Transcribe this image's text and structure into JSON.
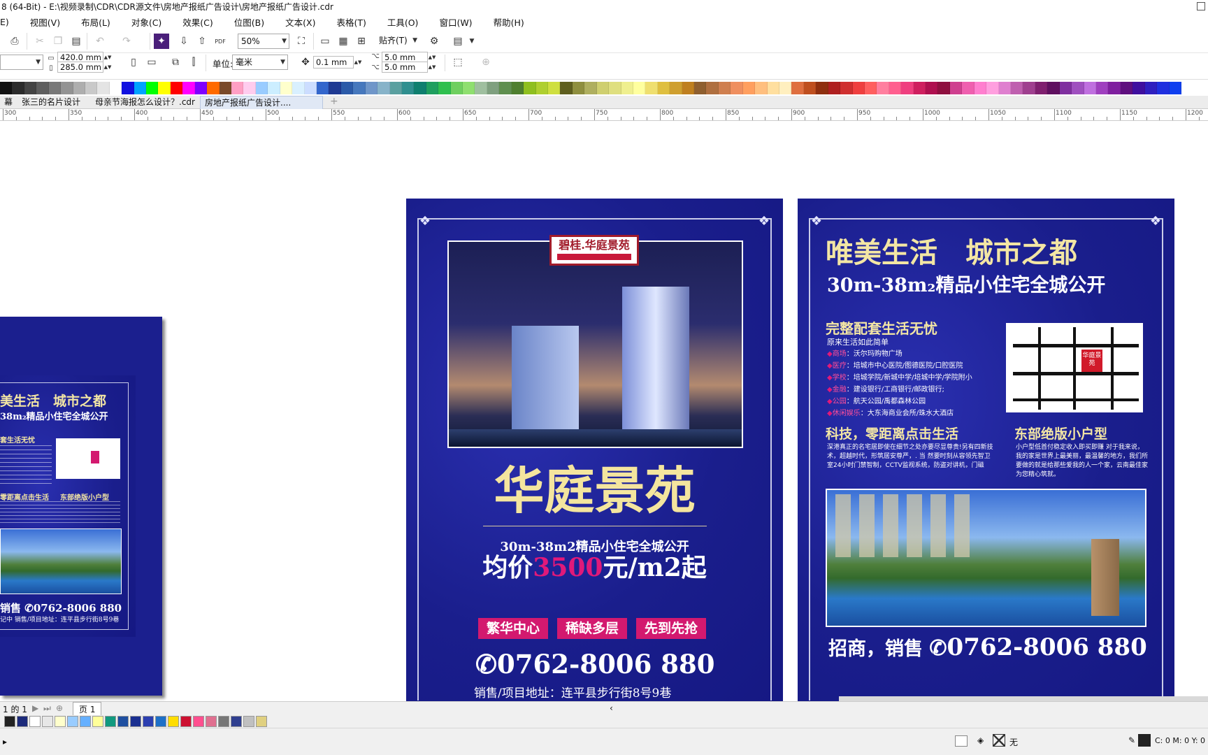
{
  "window": {
    "title": "8 (64-Bit) - E:\\视频录制\\CDR\\CDR源文件\\房地产报纸广告设计\\房地产报纸广告设计.cdr"
  },
  "menu": [
    "E)",
    "视图(V)",
    "布局(L)",
    "对象(C)",
    "效果(C)",
    "位图(B)",
    "文本(X)",
    "表格(T)",
    "工具(O)",
    "窗口(W)",
    "帮助(H)"
  ],
  "toolbar": {
    "zoom_value": "50%",
    "snap_label": "贴齐(T)",
    "pdf_label": "PDF"
  },
  "propertybar": {
    "width_value": "420.0 mm",
    "height_value": "285.0 mm",
    "units_label": "单位:",
    "units_value": "毫米",
    "nudge_value": "0.1 mm",
    "dup_x_value": "5.0 mm",
    "dup_y_value": "5.0 mm"
  },
  "palette_colors": [
    "#111111",
    "#2b2b2b",
    "#444444",
    "#5e5e5e",
    "#787878",
    "#939393",
    "#aeaeae",
    "#c9c9c9",
    "#e4e4e4",
    "#ffffff",
    "#1010e0",
    "#00a2ff",
    "#00ff00",
    "#ffff00",
    "#ff0000",
    "#ff00ff",
    "#7f00ff",
    "#ff6a00",
    "#7a4a2a",
    "#ff9fc4",
    "#ffccee",
    "#99ccff",
    "#cceeff",
    "#ffffcc",
    "#d9f0ff",
    "#ccddff",
    "#3366cc",
    "#1f3a93",
    "#2b5aa8",
    "#4678bd",
    "#6f96c9",
    "#87b3c9",
    "#5aa0a0",
    "#2f8f8f",
    "#0f7f6f",
    "#1f9f5f",
    "#2fbf4f",
    "#6fcf5f",
    "#8fdf6f",
    "#9fbf9f",
    "#7fa07f",
    "#5f8f4f",
    "#4f7f2f",
    "#8fbf1f",
    "#afcf2f",
    "#cfdf3f",
    "#5f5f1f",
    "#8f8f3f",
    "#afaf5f",
    "#cfcf6f",
    "#dfdf7f",
    "#efef8f",
    "#ffff9f",
    "#efdf6f",
    "#dfbf3f",
    "#cf9f2f",
    "#bf7f1f",
    "#8f5f2f",
    "#af6f3f",
    "#cf7f4f",
    "#ef8f5f",
    "#ff9f5f",
    "#ffbf7f",
    "#ffdf9f",
    "#ffefbf",
    "#df6f3f",
    "#bf4f1f",
    "#8f2f0f",
    "#af1f1f",
    "#cf2f2f",
    "#ef3f3f",
    "#ff5f5f",
    "#ff7f9f",
    "#ff5f8f",
    "#ef3f7f",
    "#cf1f5f",
    "#af0f4f",
    "#8f0f3f",
    "#cf3f8f",
    "#ef5faf",
    "#ff7fcf",
    "#ff9fdf",
    "#df7fcf",
    "#bf5faf",
    "#9f3f8f",
    "#7f1f6f",
    "#5f0f5f",
    "#7f2f9f",
    "#9f4fbf",
    "#bf6fdf",
    "#9f3fbf",
    "#7f1f9f",
    "#5f0f7f",
    "#3f0f9f",
    "#2f1fbf",
    "#1f2fdf",
    "#0f3fef"
  ],
  "doc_tabs": [
    "幕",
    "张三的名片设计",
    "母亲节海报怎么设计？.cdr",
    "房地产报纸广告设计...."
  ],
  "ruler_ticks": [
    "300",
    "350",
    "400",
    "450",
    "500",
    "550",
    "600",
    "650",
    "700",
    "750",
    "800",
    "850",
    "900",
    "950",
    "1000",
    "1050",
    "1100",
    "1150",
    "1200"
  ],
  "poster_left": {
    "logo_text": "碧桂.华庭景苑",
    "title": "华庭景苑",
    "subtitle": "30m-38m2精品小住宅全城公开",
    "price_prefix": "均价",
    "price_value": "3500",
    "price_suffix": "元/m2起",
    "tags": [
      "繁华中心",
      "稀缺多层",
      "先到先抢"
    ],
    "phone": "0762-8006 880",
    "address": "销售/项目地址：连平县步行街8号9巷"
  },
  "poster_right": {
    "headline": "唯美生活　城市之都",
    "subhead": "30m-38m₂精品小住宅全城公开",
    "section1_title": "完整配套生活无忧",
    "section1_sub": "原来生活如此简单",
    "amenities": [
      {
        "key": "商场",
        "val": "：沃尔玛购物广场"
      },
      {
        "key": "医疗",
        "val": "：培城市中心医院/图德医院/口腔医院"
      },
      {
        "key": "学校",
        "val": "：培城学院/新城中学/培城中学/学院附小"
      },
      {
        "key": "金融",
        "val": "：建设银行/工商银行/邮政银行;"
      },
      {
        "key": "公园",
        "val": "：航天公园/禹都森林公园"
      },
      {
        "key": "休闲娱乐",
        "val": "：大东海商业会所/珠水大酒店"
      }
    ],
    "map_badge": "华庭景苑",
    "section2_title": "科技，零距离点击生活",
    "section2_body": "深港真正的名宅居即使在细节之处亦要尽显尊贵!另有四新技术，超越时代，形筑居安尊严，. 当 然要时刻从容领先智卫室24小时门禁智制，CCTV监视系统，防盗对讲机，门磁",
    "section3_title": "东部绝版小户型",
    "section3_body": "小户型低首付稳定收入即买即赚 对于我来说，我的家是世界上最美丽，最温馨的地方，我们所要做的就是给那些爱我的人一个家，云南最佳家为您精心筑就。",
    "footer_prefix": "招商，销售",
    "footer_phone": "0762-8006 880"
  },
  "poster_thumb": {
    "headline": "美生活　城市之都",
    "subhead": "38m₂精品小住宅全城公开",
    "section1": "套生活无忧",
    "section2": "零距离点击生活",
    "section3": "东部绝版小户型",
    "phone_prefix": "销售",
    "phone": "0762-8006 880",
    "address": "记中 销售/项目地址：连平县步行街8号9巷"
  },
  "page_nav": {
    "page_count": "1 的 1",
    "page_tab": "页 1"
  },
  "bottom_palette": [
    "#222222",
    "#1c2a7a",
    "#ffffff",
    "#e7e7e7",
    "#ffffcc",
    "#99ccff",
    "#66b0ff",
    "#ffff99",
    "#11997f",
    "#1f4fa0",
    "#1a2f90",
    "#2c3fb0",
    "#1e70c8",
    "#ffdd00",
    "#cc1030",
    "#ff4f8f",
    "#e07090",
    "#777777",
    "#2f3f8f",
    "#c0c0c0",
    "#e0d080"
  ],
  "status": {
    "fill_label": "无",
    "color_readout": "C: 0 M: 0 Y: 0 K"
  }
}
